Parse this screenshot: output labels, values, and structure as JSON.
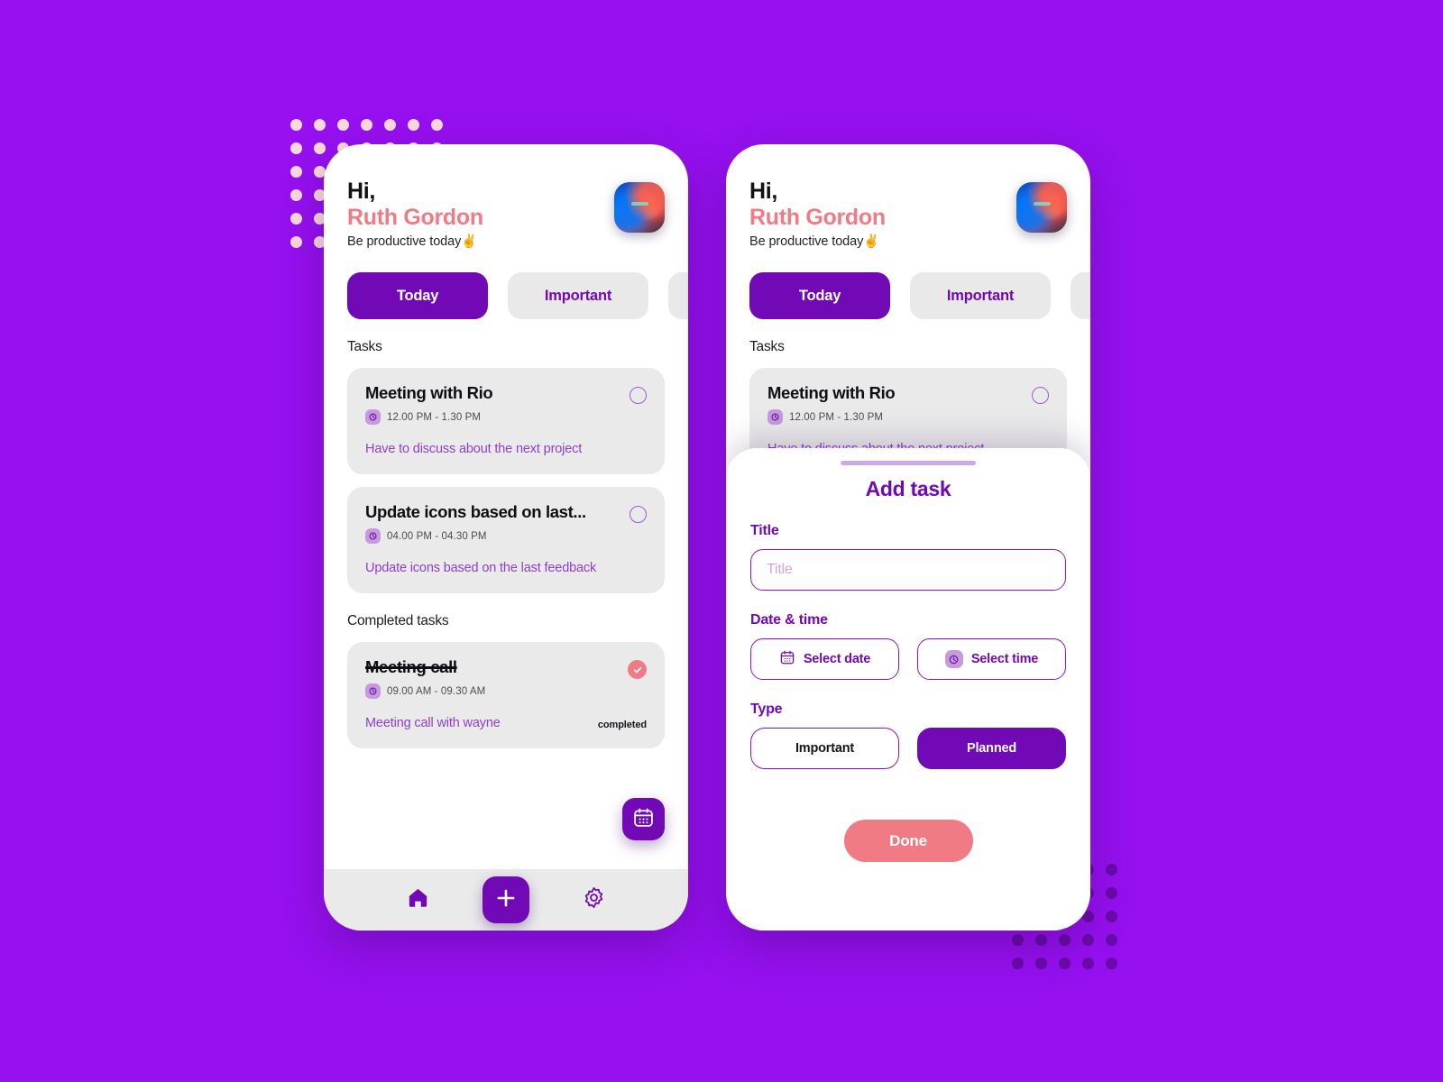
{
  "theme": {
    "background_purple": "#9610f0",
    "accent_purple": "#7209b7",
    "accent_coral": "#f07b85",
    "card_gray": "#eaeaeb",
    "dot_light": "#fbd9df",
    "dot_dark": "#6a0bab"
  },
  "header": {
    "greeting": "Hi,",
    "user_name": "Ruth Gordon",
    "subtitle": "Be productive today✌️"
  },
  "tabs": [
    {
      "label": "Today",
      "active": true
    },
    {
      "label": "Important",
      "active": false
    },
    {
      "label": "",
      "active": false
    }
  ],
  "sections": {
    "tasks_label": "Tasks",
    "completed_label": "Completed tasks"
  },
  "tasks": [
    {
      "title": "Meeting with Rio",
      "time": "12.00 PM - 1.30 PM",
      "description": "Have to discuss about the next project",
      "status": "",
      "completed": false
    },
    {
      "title": "Update icons based on last...",
      "time": "04.00 PM - 04.30 PM",
      "description": "Update icons based on the last feedback",
      "status": "",
      "completed": false
    }
  ],
  "completed_tasks": [
    {
      "title": "Meeting call",
      "time": "09.00 AM - 09.30 AM",
      "description": "Meeting call with wayne",
      "status": "completed",
      "completed": true
    }
  ],
  "bottom_nav": {
    "home": "home-icon",
    "add": "plus-icon",
    "settings": "gear-icon"
  },
  "calendar_fab": "calendar-icon",
  "modal": {
    "title": "Add task",
    "title_label": "Title",
    "title_placeholder": "Title",
    "title_value": "",
    "datetime_label": "Date & time",
    "select_date": "Select date",
    "select_time": "Select time",
    "type_label": "Type",
    "type_options": [
      {
        "label": "Important",
        "selected": false
      },
      {
        "label": "Planned",
        "selected": true
      }
    ],
    "done_label": "Done"
  }
}
